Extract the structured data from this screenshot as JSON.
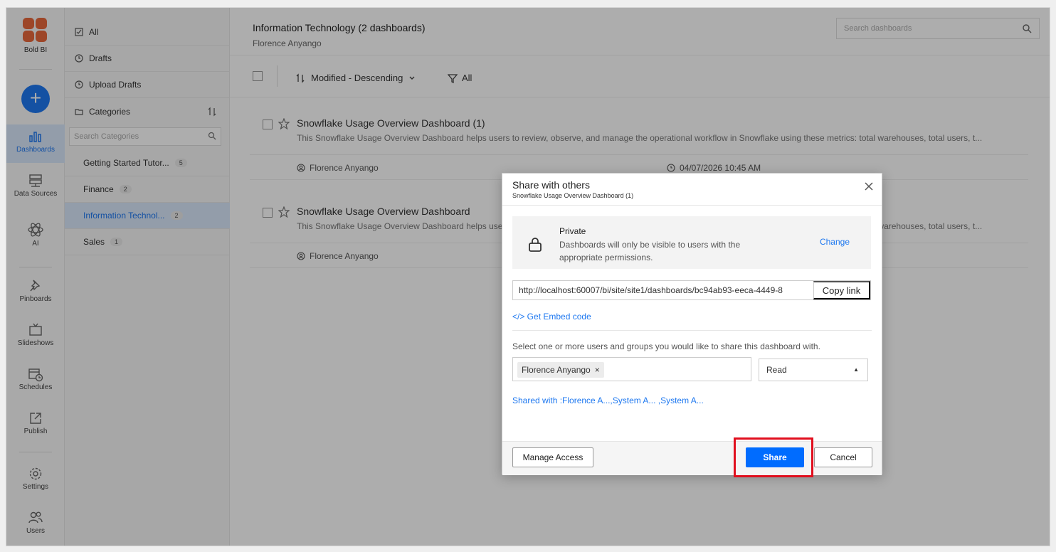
{
  "brand": {
    "name": "Bold BI",
    "accent": "#1e78f0",
    "highlight_color": "#e10f1e"
  },
  "rail": {
    "items": [
      {
        "label": "Dashboards",
        "icon": "bar-chart-icon"
      },
      {
        "label": "Data Sources",
        "icon": "database-icon"
      },
      {
        "label": "AI",
        "icon": "atom-icon"
      },
      {
        "label": "Pinboards",
        "icon": "pin-icon"
      },
      {
        "label": "Slideshows",
        "icon": "tv-icon"
      },
      {
        "label": "Schedules",
        "icon": "calendar-clock-icon"
      },
      {
        "label": "Publish",
        "icon": "publish-icon"
      },
      {
        "label": "Settings",
        "icon": "gear-icon"
      },
      {
        "label": "Users",
        "icon": "users-icon"
      }
    ]
  },
  "categories_panel": {
    "all": "All",
    "drafts": "Drafts",
    "upload_drafts": "Upload Drafts",
    "categories": "Categories",
    "search_placeholder": "Search Categories",
    "items": [
      {
        "label": "Getting Started Tutor...",
        "count": "5"
      },
      {
        "label": "Finance",
        "count": "2"
      },
      {
        "label": "Information Technol...",
        "count": "2"
      },
      {
        "label": "Sales",
        "count": "1"
      }
    ]
  },
  "main": {
    "title": "Information Technology (2 dashboards)",
    "subtitle": "Florence Anyango",
    "search_placeholder": "Search dashboards",
    "sort_label": "Modified - Descending",
    "filter_label": "All",
    "dashboards": [
      {
        "title": "Snowflake Usage Overview Dashboard (1)",
        "description": "This Snowflake Usage Overview Dashboard helps users to review, observe, and manage the operational workflow in Snowflake using these metrics: total warehouses, total users, t...",
        "owner": "Florence Anyango",
        "modified": "04/07/2026 10:45 AM"
      },
      {
        "title": "Snowflake Usage Overview Dashboard",
        "description": "This Snowflake Usage Overview Dashboard helps users to review, observe, and manage the operational workflow in Snowflake using these metrics: total warehouses, total users, t...",
        "owner": "Florence Anyango"
      }
    ]
  },
  "modal": {
    "title": "Share with others",
    "subtitle": "Snowflake Usage Overview Dashboard (1)",
    "privacy_title": "Private",
    "privacy_desc": "Dashboards will only be visible to users with the appropriate permissions.",
    "change_label": "Change",
    "link_value": "http://localhost:60007/bi/site/site1/dashboards/bc94ab93-eeca-4449-8",
    "copy_label": "Copy link",
    "embed_label": "</> Get Embed code",
    "select_label": "Select one or more users and groups you would like to share this dashboard with.",
    "chip_user": "Florence Anyango",
    "permission": "Read",
    "shared_with": "Shared with :Florence A...,System A...  ,System A...",
    "manage_label": "Manage Access",
    "share_label": "Share",
    "cancel_label": "Cancel"
  }
}
